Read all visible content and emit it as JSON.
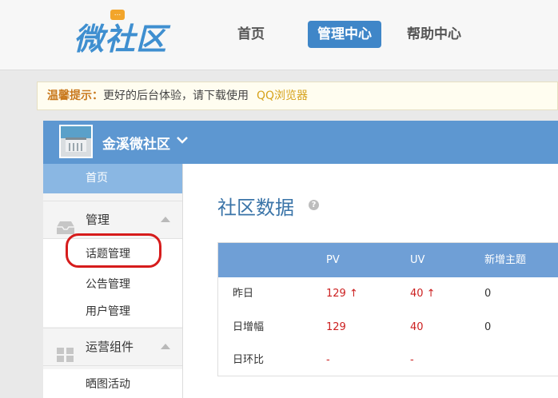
{
  "header": {
    "logo": "微社区",
    "logo_badge": "...",
    "nav": [
      {
        "label": "首页"
      },
      {
        "label": "管理中心",
        "active": true
      },
      {
        "label": "帮助中心"
      }
    ]
  },
  "tip": {
    "label": "温馨提示：",
    "text": "更好的后台体验，请下载使用",
    "link": "QQ浏览器"
  },
  "community": {
    "name": "金溪微社区",
    "chevron": "⌄"
  },
  "sidebar": {
    "home": "首页",
    "groups": [
      {
        "label": "管理",
        "icon": "inbox-icon",
        "items": [
          "话题管理",
          "公告管理",
          "用户管理"
        ]
      },
      {
        "label": "运营组件",
        "icon": "grid-icon",
        "items": [
          "晒图活动"
        ]
      }
    ],
    "highlighted_item": "话题管理"
  },
  "main": {
    "title": "社区数据",
    "help": "?",
    "table": {
      "columns": [
        "",
        "PV",
        "UV",
        "新增主题"
      ],
      "rows": [
        {
          "label": "昨日",
          "pv": "129 ↑",
          "uv": "40 ↑",
          "new": "0"
        },
        {
          "label": "日增幅",
          "pv": "129",
          "uv": "40",
          "new": "0"
        },
        {
          "label": "日环比",
          "pv": "-",
          "uv": "-",
          "new": ""
        }
      ]
    }
  },
  "colors": {
    "accent": "#3f86c8",
    "sidebar_active": "#8ab7e3",
    "table_header": "#6f9fd6",
    "highlight_ring": "#d61c1c",
    "data_red": "#cc1f1f"
  }
}
